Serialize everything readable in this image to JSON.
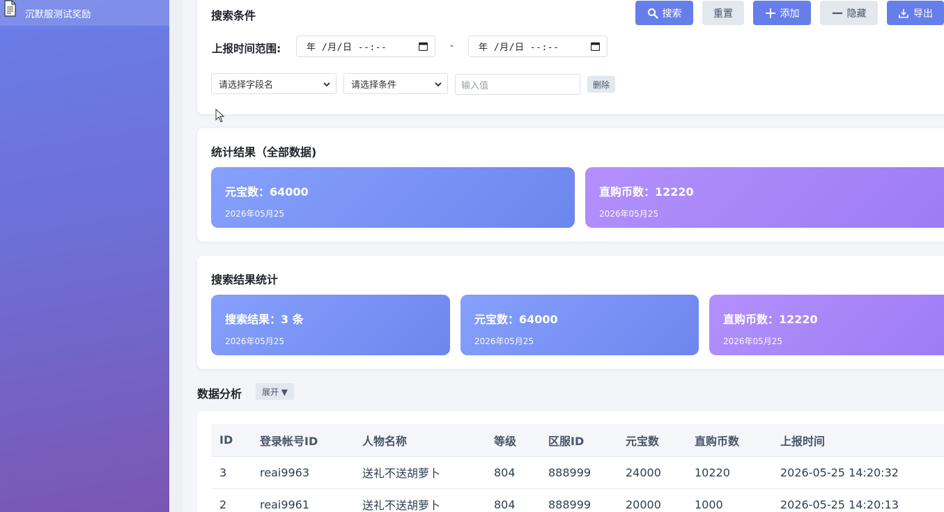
{
  "sidebar": {
    "items": [
      {
        "label": "沉默服测试奖励",
        "icon": "document-icon"
      }
    ]
  },
  "search_panel": {
    "title": "搜索条件",
    "buttons": {
      "search": "搜索",
      "reset": "重置",
      "add": "添加",
      "hide": "隐藏",
      "export": "导出"
    },
    "time_range_label": "上报时间范围:",
    "date_from": "年 /月/日 --:--",
    "date_to": "年 /月/日 --:--",
    "separator": "-",
    "filter": {
      "field_select": "请选择字段名",
      "condition_select": "请选择条件",
      "value_placeholder": "输入值",
      "delete_label": "删除"
    }
  },
  "stats_all": {
    "title": "统计结果（全部数据)",
    "cards": [
      {
        "title": "元宝数：64000",
        "date": "2026年05月25",
        "color": "blue"
      },
      {
        "title": "直购币数：12220",
        "date": "2026年05月25",
        "color": "purple"
      }
    ]
  },
  "stats_search": {
    "title": "搜索结果统计",
    "cards": [
      {
        "title": "搜索结果：3 条",
        "date": "2026年05月25",
        "color": "blue"
      },
      {
        "title": "元宝数：64000",
        "date": "2026年05月25",
        "color": "blue"
      },
      {
        "title": "直购币数：12220",
        "date": "2026年05月25",
        "color": "purple"
      }
    ]
  },
  "analysis": {
    "title": "数据分析",
    "expand_label": "展开 ▼"
  },
  "table": {
    "columns": [
      "ID",
      "登录帐号ID",
      "人物名称",
      "等级",
      "区服ID",
      "元宝数",
      "直购币数",
      "上报时间"
    ],
    "rows": [
      [
        "3",
        "reai9963",
        "送礼不送胡萝卜",
        "804",
        "888999",
        "24000",
        "10220",
        "2026-05-25 14:20:32"
      ],
      [
        "2",
        "reai9961",
        "送礼不送胡萝卜",
        "804",
        "888999",
        "20000",
        "1000",
        "2026-05-25 14:20:13"
      ]
    ]
  },
  "colors": {
    "primary": "#667eea",
    "card_blue": "#7b93f5",
    "card_purple": "#a884f8",
    "sidebar_top": "#6a7ee8",
    "sidebar_bottom": "#7a56b3"
  }
}
